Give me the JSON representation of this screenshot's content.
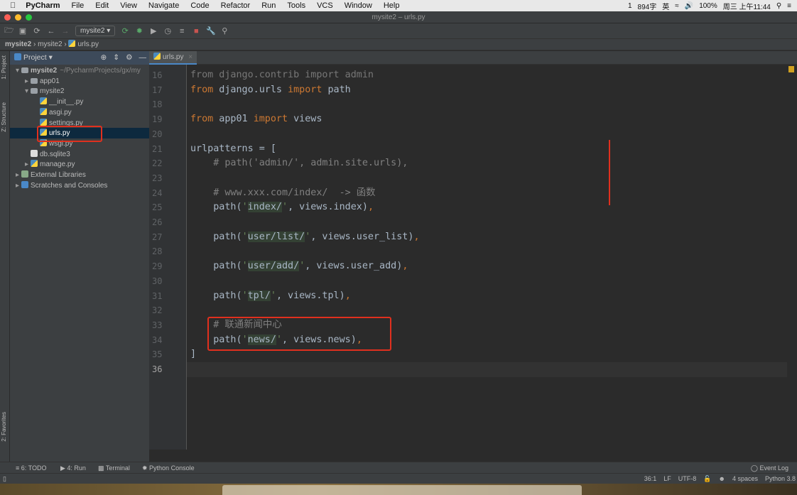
{
  "menubar": {
    "app": "PyCharm",
    "items": [
      "File",
      "Edit",
      "View",
      "Navigate",
      "Code",
      "Refactor",
      "Run",
      "Tools",
      "VCS",
      "Window",
      "Help"
    ],
    "status": {
      "word_count": "894字",
      "input": "英",
      "battery": "100%",
      "clock": "周三 上午11:44",
      "badge": "1"
    }
  },
  "window": {
    "title": "mysite2 – urls.py"
  },
  "toolbar": {
    "run_config": "mysite2"
  },
  "breadcrumb": [
    "mysite2",
    "mysite2",
    "urls.py"
  ],
  "left_strip": {
    "project": "1: Project",
    "structure": "Z: Structure",
    "favorites": "2: Favorites"
  },
  "project_panel": {
    "title": "Project",
    "tree": [
      {
        "label": "mysite2",
        "extra": "~/PycharmProjects/gx/my",
        "type": "folder",
        "open": true,
        "depth": 0
      },
      {
        "label": "app01",
        "type": "folder",
        "open": false,
        "depth": 1
      },
      {
        "label": "mysite2",
        "type": "folder",
        "open": true,
        "depth": 1
      },
      {
        "label": "__init__.py",
        "type": "py",
        "depth": 2
      },
      {
        "label": "asgi.py",
        "type": "py",
        "depth": 2
      },
      {
        "label": "settings.py",
        "type": "py",
        "depth": 2
      },
      {
        "label": "urls.py",
        "type": "py",
        "depth": 2,
        "selected": true
      },
      {
        "label": "wsgi.py",
        "type": "py",
        "depth": 2
      },
      {
        "label": "db.sqlite3",
        "type": "db",
        "depth": 1
      },
      {
        "label": "manage.py",
        "type": "py",
        "depth": 1,
        "arrow": true
      },
      {
        "label": "External Libraries",
        "type": "lib",
        "depth": 0,
        "arrow": true
      },
      {
        "label": "Scratches and Consoles",
        "type": "scratch",
        "depth": 0,
        "arrow": true
      }
    ]
  },
  "editor": {
    "tab": "urls.py",
    "lines": [
      {
        "n": "16",
        "t": "from django.contrib import admin"
      },
      {
        "n": "17",
        "t": "from django.urls import path"
      },
      {
        "n": "18",
        "t": ""
      },
      {
        "n": "19",
        "t": "from app01 import views"
      },
      {
        "n": "20",
        "t": ""
      },
      {
        "n": "21",
        "t": "urlpatterns = ["
      },
      {
        "n": "22",
        "t": "    # path('admin/', admin.site.urls),"
      },
      {
        "n": "23",
        "t": ""
      },
      {
        "n": "24",
        "t": "    # www.xxx.com/index/  -> 函数"
      },
      {
        "n": "25",
        "t": "    path('index/', views.index),"
      },
      {
        "n": "26",
        "t": ""
      },
      {
        "n": "27",
        "t": "    path('user/list/', views.user_list),"
      },
      {
        "n": "28",
        "t": ""
      },
      {
        "n": "29",
        "t": "    path('user/add/', views.user_add),"
      },
      {
        "n": "30",
        "t": ""
      },
      {
        "n": "31",
        "t": "    path('tpl/', views.tpl),"
      },
      {
        "n": "32",
        "t": ""
      },
      {
        "n": "33",
        "t": "    # 联通新闻中心"
      },
      {
        "n": "34",
        "t": "    path('news/', views.news),"
      },
      {
        "n": "35",
        "t": "]"
      },
      {
        "n": "36",
        "t": ""
      }
    ]
  },
  "bottom_tools": [
    "6: TODO",
    "4: Run",
    "Terminal",
    "Python Console"
  ],
  "event_log": "Event Log",
  "status": {
    "position": "36:1",
    "line_sep": "LF",
    "encoding": "UTF-8",
    "indent": "4 spaces",
    "interpreter": "Python 3.8"
  },
  "colors": {
    "highlight": "#e0301e",
    "keyword": "#cc7832",
    "selection": "#0d293e"
  }
}
